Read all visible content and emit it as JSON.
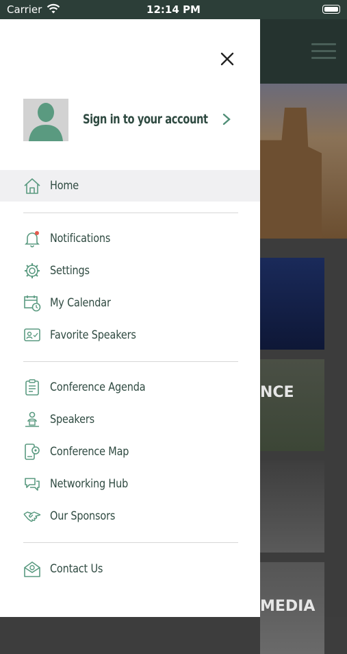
{
  "status_bar": {
    "carrier": "Carrier",
    "time": "12:14 PM"
  },
  "background": {
    "card2_text": "NCE",
    "card4_text": "MEDIA"
  },
  "drawer": {
    "profile": {
      "label": "Sign in to your account",
      "avatar_icon": "person-silhouette-icon",
      "chevron_icon": "chevron-right-icon"
    },
    "close_icon": "close-icon",
    "accent_color": "#4f8e76",
    "text_color": "#2f4a41",
    "sections": [
      {
        "items": [
          {
            "label": "Home",
            "icon": "home-icon",
            "active": true
          }
        ]
      },
      {
        "items": [
          {
            "label": "Notifications",
            "icon": "bell-icon",
            "badge": true
          },
          {
            "label": "Settings",
            "icon": "gear-icon"
          },
          {
            "label": "My Calendar",
            "icon": "calendar-icon"
          },
          {
            "label": "Favorite Speakers",
            "icon": "favorite-speakers-icon"
          }
        ]
      },
      {
        "items": [
          {
            "label": "Conference Agenda",
            "icon": "agenda-icon"
          },
          {
            "label": "Speakers",
            "icon": "speaker-icon"
          },
          {
            "label": "Conference Map",
            "icon": "map-icon"
          },
          {
            "label": "Networking Hub",
            "icon": "chat-icon"
          },
          {
            "label": "Our Sponsors",
            "icon": "handshake-icon"
          }
        ]
      },
      {
        "items": [
          {
            "label": "Contact Us",
            "icon": "mail-icon"
          }
        ]
      }
    ]
  }
}
